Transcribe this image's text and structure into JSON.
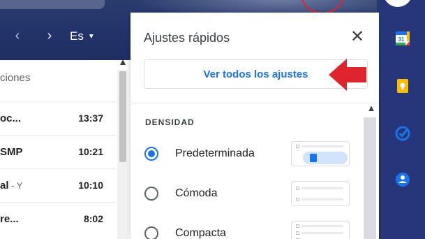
{
  "header": {
    "language": "Es"
  },
  "mail_list": {
    "top_text": "ciones",
    "rows": [
      {
        "sender": "oc...",
        "extra": "",
        "time": "13:37"
      },
      {
        "sender": "SMP",
        "extra": "",
        "time": "10:21"
      },
      {
        "sender": "al",
        "extra": " - Y",
        "time": "10:10"
      },
      {
        "sender": "re...",
        "extra": "",
        "time": "8:02"
      }
    ]
  },
  "quick_settings": {
    "title": "Ajustes rápidos",
    "see_all": "Ver todos los ajustes",
    "density_heading": "DENSIDAD",
    "density_options": [
      {
        "label": "Predeterminada",
        "selected": true
      },
      {
        "label": "Cómoda",
        "selected": false
      },
      {
        "label": "Compacta",
        "selected": false
      }
    ]
  },
  "colors": {
    "accent": "#1a73e8",
    "arrow": "#e0242f",
    "header_bg": "#22336a"
  },
  "icons": [
    "chevron-left-icon",
    "chevron-right-icon",
    "close-icon",
    "calendar-icon",
    "keep-icon",
    "tasks-icon",
    "contacts-icon"
  ]
}
